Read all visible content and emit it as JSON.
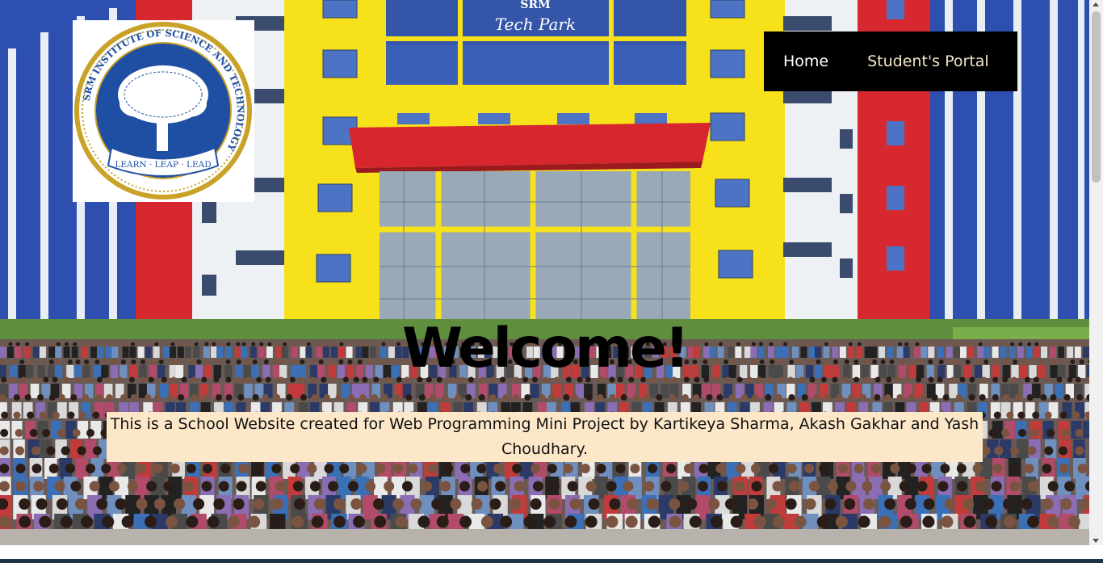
{
  "building_sign": {
    "line1": "SRM",
    "line2": "Tech Park"
  },
  "logo": {
    "alt": "SRM Institute of Science and Technology logo",
    "ring_text": "SRM INSTITUTE OF SCIENCE AND TECHNOLOGY",
    "motto": "LEARN · LEAP · LEAD"
  },
  "nav": {
    "home": "Home",
    "portal": "Student's Portal"
  },
  "hero": {
    "heading": "Welcome!",
    "description": "This is a School Website created for Web Programming Mini Project by Kartikeya Sharma, Akash Gakhar and Yash Choudhary."
  },
  "colors": {
    "nav_bg": "#000000",
    "nav_text": "#ffffff",
    "intro_bg": "#fde7c9",
    "building_yellow": "#f6e11a",
    "building_red": "#d8262e",
    "building_blue": "#2244a8",
    "logo_blue": "#1e4fa3",
    "logo_gold": "#c9a227"
  }
}
